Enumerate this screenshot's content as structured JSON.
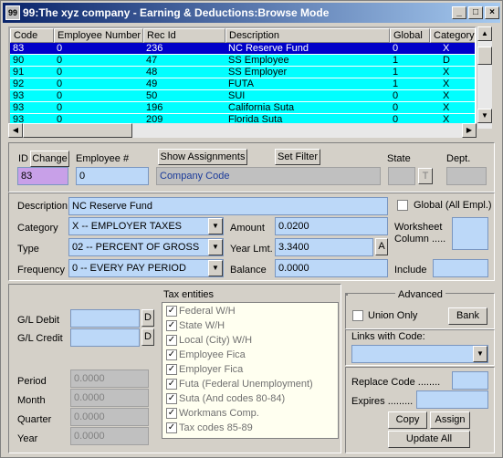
{
  "window": {
    "app_icon": "99",
    "title": "99:The xyz company - Earning & Deductions:Browse Mode",
    "controls": [
      "_",
      "□",
      "×"
    ]
  },
  "grid": {
    "columns": [
      "Code",
      "Employee Number",
      "Rec Id",
      "Description",
      "Global",
      "Category"
    ],
    "rows": [
      {
        "code": "83",
        "emp": "0",
        "rec": "236",
        "desc": "NC Reserve Fund",
        "global": "0",
        "cat": "X"
      },
      {
        "code": "90",
        "emp": "0",
        "rec": "47",
        "desc": "SS Employee",
        "global": "1",
        "cat": "D"
      },
      {
        "code": "91",
        "emp": "0",
        "rec": "48",
        "desc": "SS Employer",
        "global": "1",
        "cat": "X"
      },
      {
        "code": "92",
        "emp": "0",
        "rec": "49",
        "desc": "FUTA",
        "global": "1",
        "cat": "X"
      },
      {
        "code": "93",
        "emp": "0",
        "rec": "50",
        "desc": "SUI",
        "global": "0",
        "cat": "X"
      },
      {
        "code": "93",
        "emp": "0",
        "rec": "196",
        "desc": "California Suta",
        "global": "0",
        "cat": "X"
      },
      {
        "code": "93",
        "emp": "0",
        "rec": "209",
        "desc": "Florida Suta",
        "global": "0",
        "cat": "X"
      }
    ]
  },
  "header": {
    "id_label": "ID",
    "change_label": "Change",
    "emp_label": "Employee #",
    "show_assignments": "Show Assignments",
    "set_filter": "Set Filter",
    "state_label": "State",
    "state_btn": "T",
    "dept_label": "Dept.",
    "id_value": "83",
    "emp_value": "0",
    "company_code": "Company Code"
  },
  "detail": {
    "description_label": "Description",
    "description_value": "NC Reserve Fund",
    "category_label": "Category",
    "category_value": "X -- EMPLOYER TAXES",
    "type_label": "Type",
    "type_value": "02 -- PERCENT OF GROSS",
    "frequency_label": "Frequency",
    "frequency_value": "0 -- EVERY PAY PERIOD",
    "amount_label": "Amount",
    "amount_value": "0.0200",
    "yearlmt_label": "Year Lmt.",
    "yearlmt_value": "3.3400",
    "yearlmt_btn": "A",
    "balance_label": "Balance",
    "balance_value": "0.0000",
    "global_label": "Global (All Empl.)",
    "worksheet_label": "Worksheet\nColumn .....",
    "include_label": "Include"
  },
  "gl": {
    "debit_label": "G/L Debit",
    "credit_label": "G/L Credit",
    "d_btn": "D",
    "period_label": "Period",
    "month_label": "Month",
    "quarter_label": "Quarter",
    "year_label": "Year",
    "period_value": "0.0000",
    "month_value": "0.0000",
    "quarter_value": "0.0000",
    "year_value": "0.0000"
  },
  "tax": {
    "title": "Tax entities",
    "items": [
      "Federal W/H",
      "State W/H",
      "Local (City) W/H",
      "Employee Fica",
      "Employer Fica",
      "Futa (Federal Unemployment)",
      "Suta (And codes 80-84)",
      "Workmans Comp.",
      "Tax codes 85-89"
    ]
  },
  "advanced": {
    "title": "Advanced",
    "union_only": "Union Only",
    "bank": "Bank",
    "links_label": "Links with Code:",
    "replace_label": "Replace Code ........",
    "expires_label": "Expires .........",
    "copy": "Copy",
    "assign": "Assign",
    "update_all": "Update All"
  }
}
